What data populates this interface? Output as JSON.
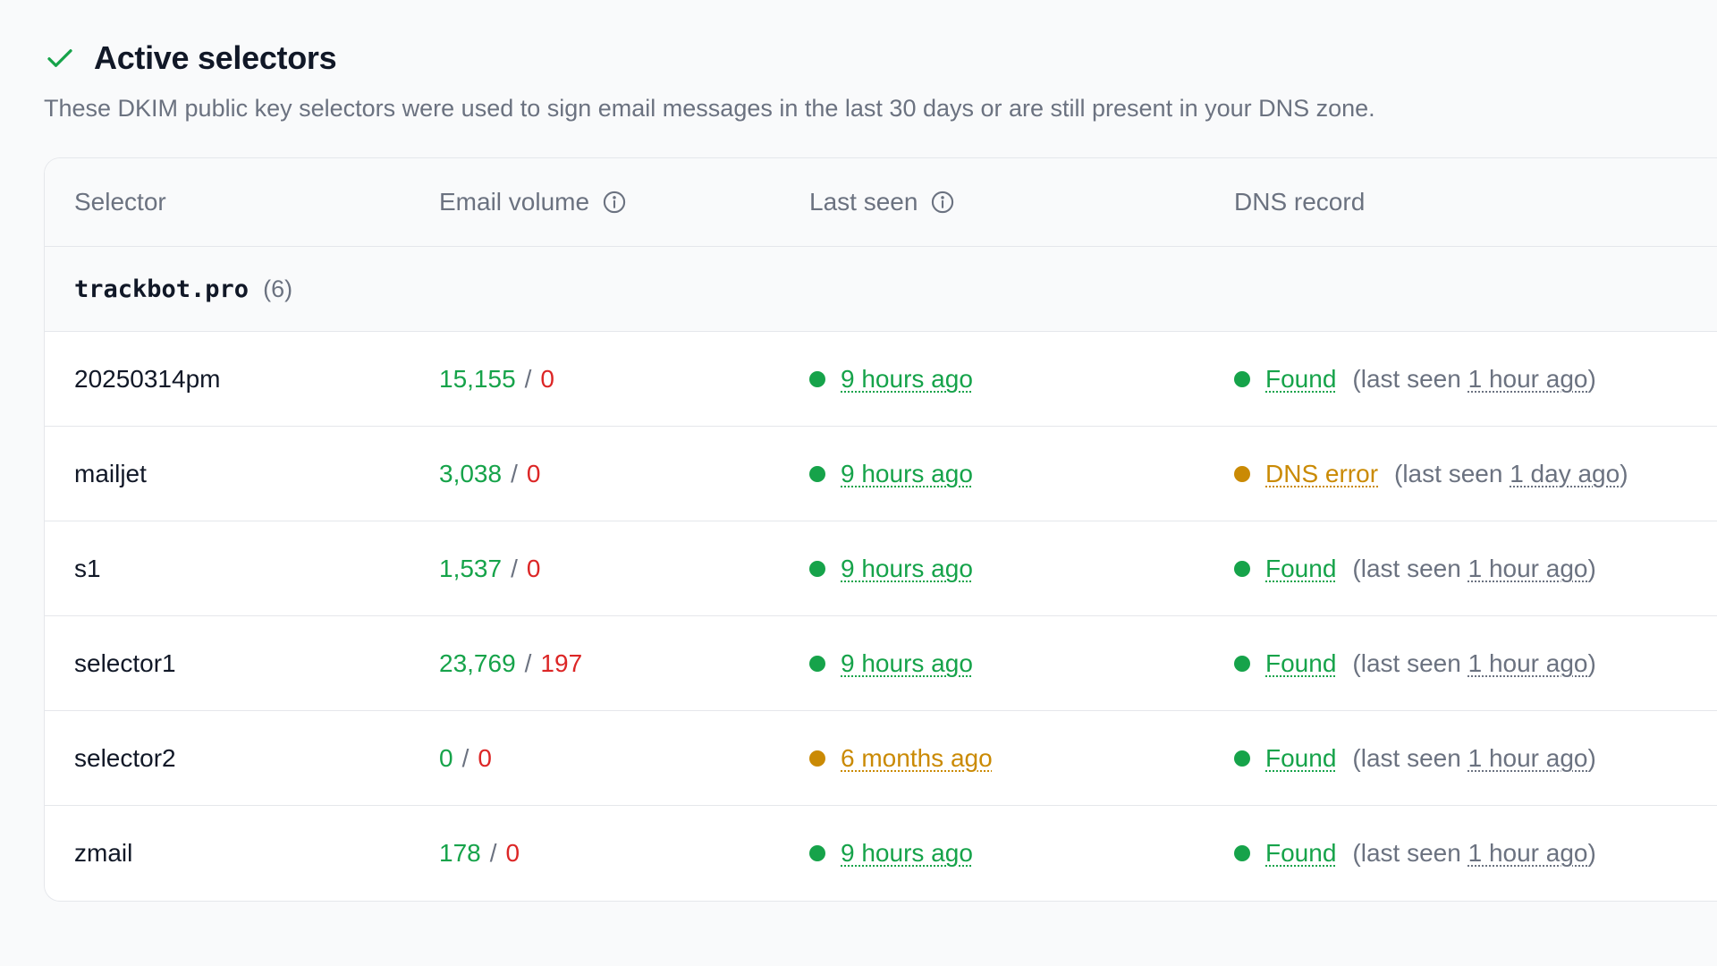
{
  "section": {
    "title": "Active selectors",
    "description": "These DKIM public key selectors were used to sign email messages in the last 30 days or are still present in your DNS zone.",
    "accent_color": "#16a34a"
  },
  "table": {
    "headers": {
      "selector": "Selector",
      "email_volume": "Email volume",
      "last_seen": "Last seen",
      "dns_record": "DNS record"
    },
    "group": {
      "name": "trackbot.pro",
      "count": "(6)"
    },
    "rows": [
      {
        "selector": "20250314pm",
        "pass": "15,155",
        "fail": "0",
        "last_seen": "9 hours ago",
        "last_seen_status": "ok",
        "dns": "Found",
        "dns_status": "ok",
        "dns_prefix": "(last seen",
        "dns_last": "1 hour ago",
        "dns_suffix": ")"
      },
      {
        "selector": "mailjet",
        "pass": "3,038",
        "fail": "0",
        "last_seen": "9 hours ago",
        "last_seen_status": "ok",
        "dns": "DNS error",
        "dns_status": "warn",
        "dns_prefix": "(last seen",
        "dns_last": "1 day ago",
        "dns_suffix": ")"
      },
      {
        "selector": "s1",
        "pass": "1,537",
        "fail": "0",
        "last_seen": "9 hours ago",
        "last_seen_status": "ok",
        "dns": "Found",
        "dns_status": "ok",
        "dns_prefix": "(last seen",
        "dns_last": "1 hour ago",
        "dns_suffix": ")"
      },
      {
        "selector": "selector1",
        "pass": "23,769",
        "fail": "197",
        "last_seen": "9 hours ago",
        "last_seen_status": "ok",
        "dns": "Found",
        "dns_status": "ok",
        "dns_prefix": "(last seen",
        "dns_last": "1 hour ago",
        "dns_suffix": ")"
      },
      {
        "selector": "selector2",
        "pass": "0",
        "fail": "0",
        "last_seen": "6 months ago",
        "last_seen_status": "warn",
        "dns": "Found",
        "dns_status": "ok",
        "dns_prefix": "(last seen",
        "dns_last": "1 hour ago",
        "dns_suffix": ")"
      },
      {
        "selector": "zmail",
        "pass": "178",
        "fail": "0",
        "last_seen": "9 hours ago",
        "last_seen_status": "ok",
        "dns": "Found",
        "dns_status": "ok",
        "dns_prefix": "(last seen",
        "dns_last": "1 hour ago",
        "dns_suffix": ")"
      }
    ]
  },
  "colors": {
    "ok": "#16a34a",
    "warn": "#ca8a04",
    "fail": "#dc2626"
  },
  "icons": {
    "section": "check-icon",
    "header_info": "info-icon",
    "status": "status-dot"
  }
}
